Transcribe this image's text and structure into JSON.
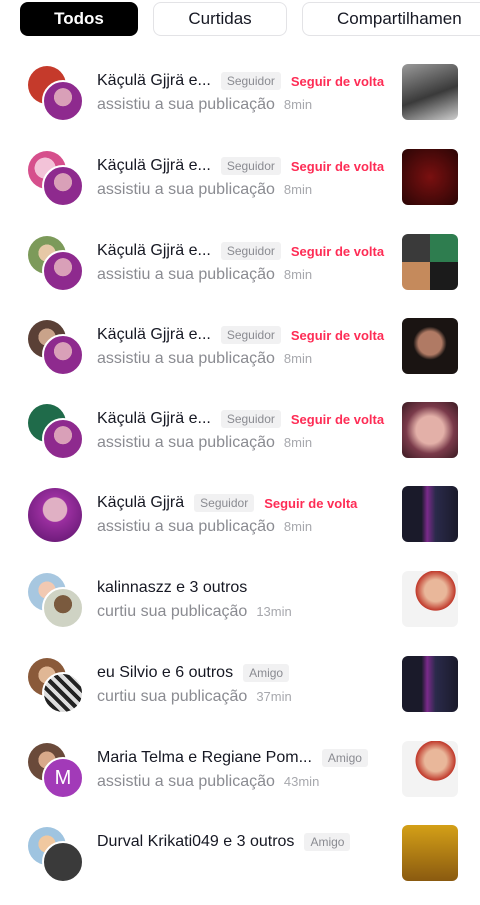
{
  "tabs": [
    {
      "label": "Todos",
      "active": true
    },
    {
      "label": "Curtidas",
      "active": false
    },
    {
      "label": "Compartilhamen",
      "active": false
    }
  ],
  "notifications": [
    {
      "name": "Käçulä Gjjrä e...",
      "badge": "Seguidor",
      "follow_back": "Seguir de volta",
      "action": "assistiu a sua publicação",
      "time": "8min"
    },
    {
      "name": "Käçulä Gjjrä e...",
      "badge": "Seguidor",
      "follow_back": "Seguir de volta",
      "action": "assistiu a sua publicação",
      "time": "8min"
    },
    {
      "name": "Käçulä Gjjrä e...",
      "badge": "Seguidor",
      "follow_back": "Seguir de volta",
      "action": "assistiu a sua publicação",
      "time": "8min"
    },
    {
      "name": "Käçulä Gjjrä e...",
      "badge": "Seguidor",
      "follow_back": "Seguir de volta",
      "action": "assistiu a sua publicação",
      "time": "8min"
    },
    {
      "name": "Käçulä Gjjrä e...",
      "badge": "Seguidor",
      "follow_back": "Seguir de volta",
      "action": "assistiu a sua publicação",
      "time": "8min"
    },
    {
      "name": "Käçulä Gjjrä",
      "badge": "Seguidor",
      "follow_back": "Seguir de volta",
      "action": "assistiu a sua publicação",
      "time": "8min"
    },
    {
      "name": "kalinnaszz e 3 outros",
      "badge": "",
      "follow_back": "",
      "action": "curtiu sua publicação",
      "time": "13min"
    },
    {
      "name": "eu Silvio e 6 outros",
      "badge": "Amigo",
      "follow_back": "",
      "action": "curtiu sua publicação",
      "time": "37min"
    },
    {
      "name": "Maria Telma e Regiane Pom...",
      "badge": "Amigo",
      "follow_back": "",
      "action": "assistiu a sua publicação",
      "time": "43min",
      "avatar_letter": "M"
    },
    {
      "name": "Durval Krikati049 e 3 outros",
      "badge": "Amigo",
      "follow_back": "",
      "action": "",
      "time": ""
    }
  ],
  "colors": {
    "accent": "#fe2c55",
    "tab_active_bg": "#000000",
    "secondary_text": "#8a8b91"
  }
}
